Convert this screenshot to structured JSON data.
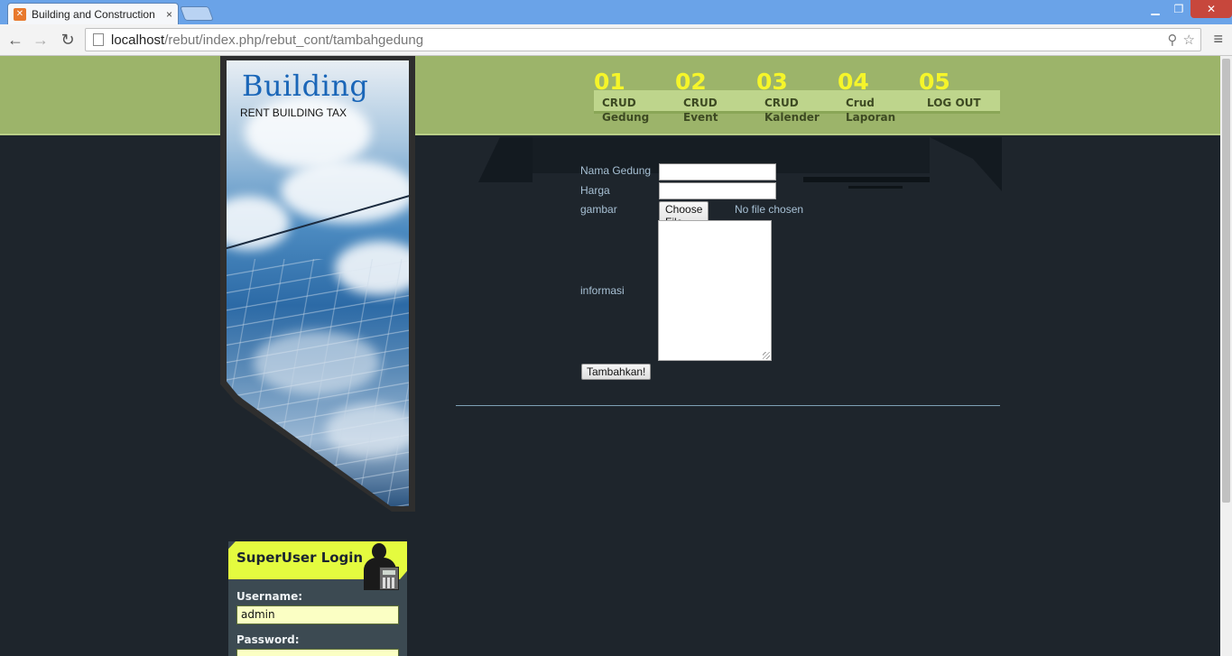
{
  "browser": {
    "tab_title": "Building and Construction",
    "tab_close": "×",
    "url_host": "localhost",
    "url_path": "/rebut/index.php/rebut_cont/tambahgedung",
    "back_icon": "←",
    "forward_icon": "→",
    "reload_icon": "↻",
    "minimize": "▁",
    "restore": "❐",
    "close": "✕",
    "zoom_icon": "⚲",
    "star_icon": "☆",
    "menu_icon": "≡"
  },
  "brand": {
    "title": "Building",
    "subtitle": "RENT BUILDING TAX"
  },
  "nav": {
    "items": [
      {
        "num": "01",
        "label": "CRUD\nGedung"
      },
      {
        "num": "02",
        "label": "CRUD\nEvent"
      },
      {
        "num": "03",
        "label": "CRUD\nKalender"
      },
      {
        "num": "04",
        "label": "Crud\nLaporan"
      },
      {
        "num": "05",
        "label": "LOG OUT"
      }
    ]
  },
  "form": {
    "nama_label": "Nama Gedung",
    "nama_value": "",
    "harga_label": "Harga",
    "harga_value": "",
    "gambar_label": "gambar",
    "file_button": "Choose File",
    "file_status": "No file chosen",
    "informasi_label": "informasi",
    "informasi_value": "",
    "submit": "Tambahkan!"
  },
  "login": {
    "title": "SuperUser Login",
    "username_label": "Username:",
    "username_value": "admin",
    "password_label": "Password:",
    "password_value": ""
  },
  "colors": {
    "page_bg": "#1e252c",
    "header_green": "#9cb46a",
    "nav_number": "#f5f52a",
    "brand_blue": "#1a66b8",
    "login_accent": "#e4fb3f"
  }
}
